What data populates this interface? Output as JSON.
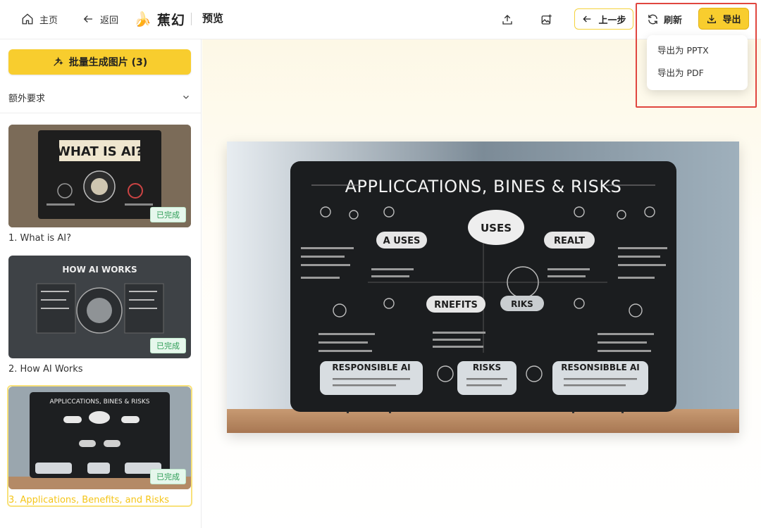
{
  "header": {
    "home_label": "主页",
    "back_label": "返回",
    "brand_name": "蕉幻",
    "page_title": "预览",
    "prev_step_label": "上一步",
    "refresh_label": "刷新",
    "export_label": "导出"
  },
  "export_menu": {
    "items": [
      "导出为 PPTX",
      "导出为 PDF"
    ]
  },
  "sidebar": {
    "batch_button_label": "批量生成图片 (3)",
    "extra_requirements_label": "额外要求",
    "slides": [
      {
        "label": "1. What is AI?",
        "status": "已完成",
        "thumb_title": "WHAT IS AI?"
      },
      {
        "label": "2. How AI Works",
        "status": "已完成",
        "thumb_title": "HOW AI WORKS"
      },
      {
        "label": "3. Applications, Benefits, and Risks",
        "status": "已完成",
        "thumb_title": "APPLICCATIONS, BINES & RISKS",
        "selected": true
      }
    ]
  },
  "preview": {
    "title": "APPLICCATIONS, BINES & RISKS",
    "bubbles": [
      "USES",
      "A USES",
      "REALT",
      "RNEFITS",
      "RIKS"
    ],
    "bottom_boxes": [
      "RESPONSIBLE AI",
      "RISKS",
      "RESONSIBBLE AI"
    ]
  },
  "colors": {
    "accent": "#f8cd2e",
    "highlight_border": "#e0463f",
    "badge_green": "#2f9d57"
  }
}
